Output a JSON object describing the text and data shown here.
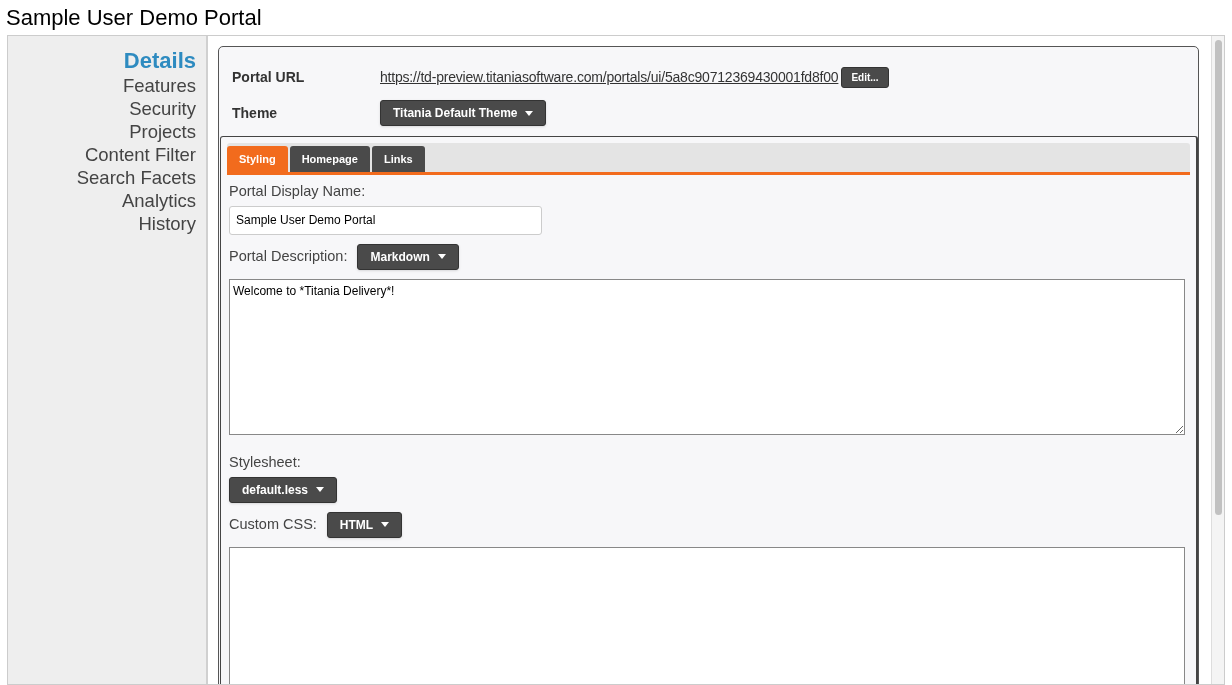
{
  "page_title": "Sample User Demo Portal",
  "sidebar": {
    "items": [
      {
        "label": "Details",
        "selected": true
      },
      {
        "label": "Features",
        "selected": false
      },
      {
        "label": "Security",
        "selected": false
      },
      {
        "label": "Projects",
        "selected": false
      },
      {
        "label": "Content Filter",
        "selected": false
      },
      {
        "label": "Search Facets",
        "selected": false
      },
      {
        "label": "Analytics",
        "selected": false
      },
      {
        "label": "History",
        "selected": false
      }
    ]
  },
  "portal_url": {
    "label": "Portal URL",
    "value": "https://td-preview.titaniasoftware.com/portals/ui/5a8c90712369430001fd8f00",
    "button": "Edit..."
  },
  "theme": {
    "label": "Theme",
    "value": "Titania Default Theme"
  },
  "tabs": [
    {
      "label": "Styling",
      "selected": true
    },
    {
      "label": "Homepage",
      "selected": false
    },
    {
      "label": "Links",
      "selected": false
    }
  ],
  "display_name": {
    "label": "Portal Display Name:",
    "value": "Sample User Demo Portal"
  },
  "description": {
    "label": "Portal Description:",
    "format": "Markdown",
    "value": "Welcome to *Titania Delivery*!"
  },
  "stylesheet": {
    "label": "Stylesheet:",
    "value": "default.less"
  },
  "custom_css": {
    "label": "Custom CSS:",
    "format": "HTML"
  }
}
